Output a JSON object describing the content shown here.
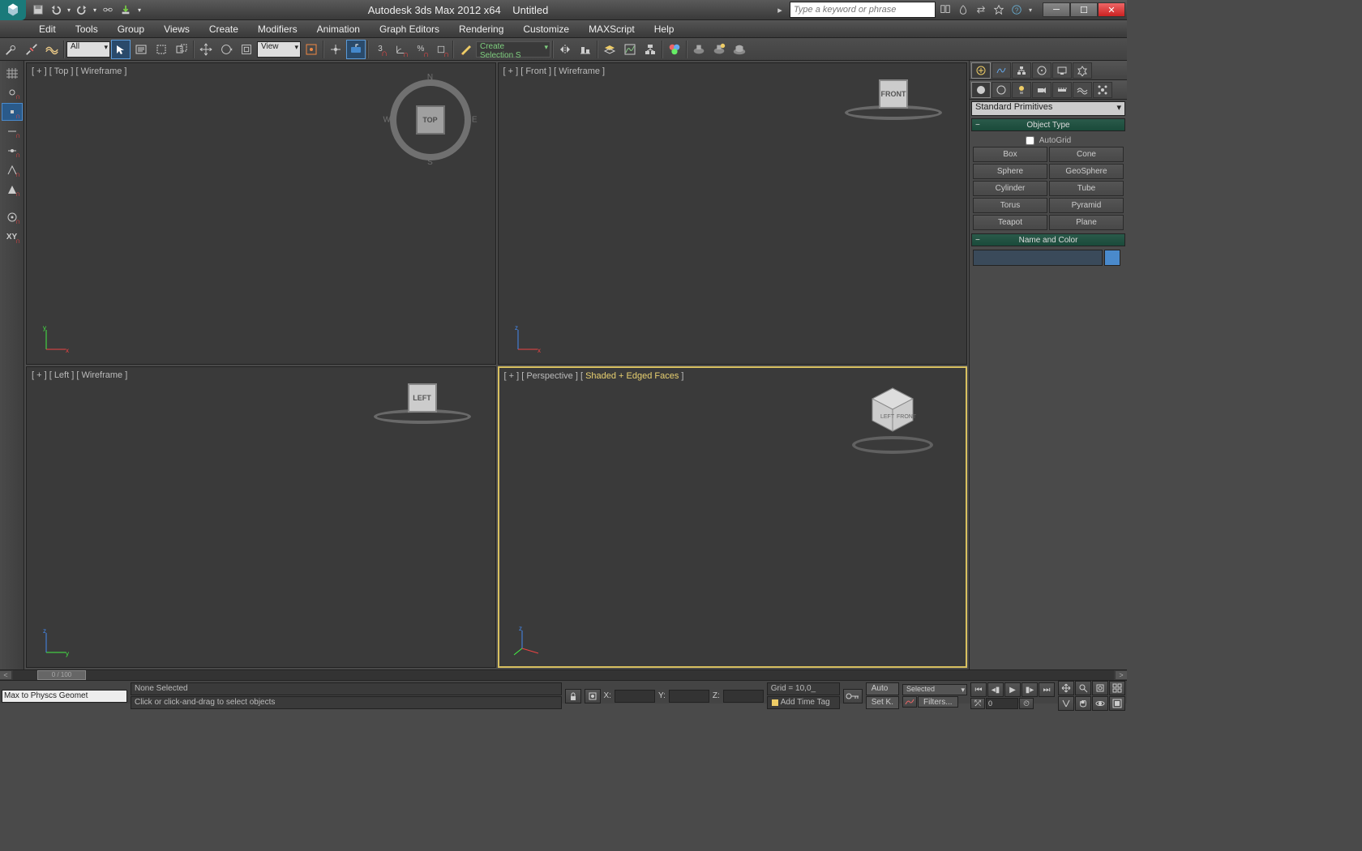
{
  "title": {
    "app": "Autodesk 3ds Max  2012 x64",
    "doc": "Untitled"
  },
  "search": {
    "placeholder": "Type a keyword or phrase"
  },
  "menus": [
    "Edit",
    "Tools",
    "Group",
    "Views",
    "Create",
    "Modifiers",
    "Animation",
    "Graph Editors",
    "Rendering",
    "Customize",
    "MAXScript",
    "Help"
  ],
  "toolbar": {
    "filter_dd": "All",
    "view_dd": "View",
    "sel_set_dd": "Create Selection S",
    "snap_num": "3"
  },
  "viewports": {
    "tl": {
      "label": "[ + ] [ Top ] [ Wireframe ]",
      "cube": "TOP"
    },
    "tr": {
      "label": "[ + ] [ Front ] [ Wireframe ]",
      "cube": "FRONT"
    },
    "bl": {
      "label": "[ + ] [ Left ] [ Wireframe ]",
      "cube": "LEFT"
    },
    "br": {
      "label_pre": "[ + ] [ Perspective ] [ ",
      "label_hl": "Shaded + Edged Faces",
      "label_post": " ]"
    }
  },
  "snapbar_xy": "XY",
  "cmd": {
    "category": "Standard Primitives",
    "rollout1": "Object Type",
    "autogrid": "AutoGrid",
    "objects": [
      "Box",
      "Cone",
      "Sphere",
      "GeoSphere",
      "Cylinder",
      "Tube",
      "Torus",
      "Pyramid",
      "Teapot",
      "Plane"
    ],
    "rollout2": "Name and Color"
  },
  "status": {
    "frame": "0 / 100",
    "macro": "Max to Physcs Geomet",
    "selection": "None Selected",
    "prompt": "Click or click-and-drag to select objects",
    "x": "X:",
    "y": "Y:",
    "z": "Z:",
    "grid": "Grid = 10,0_",
    "tag": "Add Time Tag",
    "auto": "Auto",
    "setk": "Set K.",
    "selected_dd": "Selected",
    "filters": "Filters...",
    "framebox": "0"
  }
}
